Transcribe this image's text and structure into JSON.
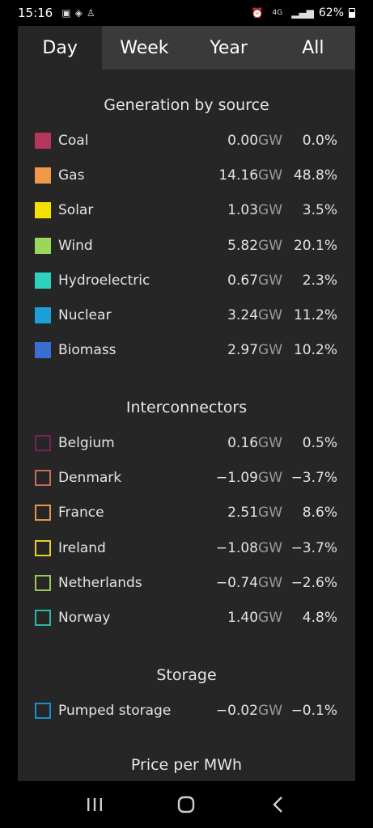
{
  "status": {
    "time": "15:16",
    "network": "4G",
    "battery": "62%"
  },
  "tabs": [
    "Day",
    "Week",
    "Year",
    "All"
  ],
  "generation": {
    "title": "Generation by source",
    "items": [
      {
        "name": "Coal",
        "value": "0.00",
        "unit": "GW",
        "pct": "0.0%",
        "color": "#b5365a"
      },
      {
        "name": "Gas",
        "value": "14.16",
        "unit": "GW",
        "pct": "48.8%",
        "color": "#f0994a"
      },
      {
        "name": "Solar",
        "value": "1.03",
        "unit": "GW",
        "pct": "3.5%",
        "color": "#f5e000"
      },
      {
        "name": "Wind",
        "value": "5.82",
        "unit": "GW",
        "pct": "20.1%",
        "color": "#98d95a"
      },
      {
        "name": "Hydroelectric",
        "value": "0.67",
        "unit": "GW",
        "pct": "2.3%",
        "color": "#2dd1bd"
      },
      {
        "name": "Nuclear",
        "value": "3.24",
        "unit": "GW",
        "pct": "11.2%",
        "color": "#1a9fd6"
      },
      {
        "name": "Biomass",
        "value": "2.97",
        "unit": "GW",
        "pct": "10.2%",
        "color": "#3a6fd0"
      }
    ]
  },
  "interconnectors": {
    "title": "Interconnectors",
    "items": [
      {
        "name": "Belgium",
        "value": "0.16",
        "unit": "GW",
        "pct": "0.5%",
        "color": "#7a1f5a"
      },
      {
        "name": "Denmark",
        "value": "−1.09",
        "unit": "GW",
        "pct": "−3.7%",
        "color": "#c96a5a"
      },
      {
        "name": "France",
        "value": "2.51",
        "unit": "GW",
        "pct": "8.6%",
        "color": "#e8954a"
      },
      {
        "name": "Ireland",
        "value": "−1.08",
        "unit": "GW",
        "pct": "−3.7%",
        "color": "#e8d020"
      },
      {
        "name": "Netherlands",
        "value": "−0.74",
        "unit": "GW",
        "pct": "−2.6%",
        "color": "#98c85a"
      },
      {
        "name": "Norway",
        "value": "1.40",
        "unit": "GW",
        "pct": "4.8%",
        "color": "#2ab8aa"
      }
    ]
  },
  "storage": {
    "title": "Storage",
    "items": [
      {
        "name": "Pumped storage",
        "value": "−0.02",
        "unit": "GW",
        "pct": "−0.1%",
        "color": "#1a8fc8"
      }
    ]
  },
  "price": {
    "title": "Price per MWh"
  }
}
